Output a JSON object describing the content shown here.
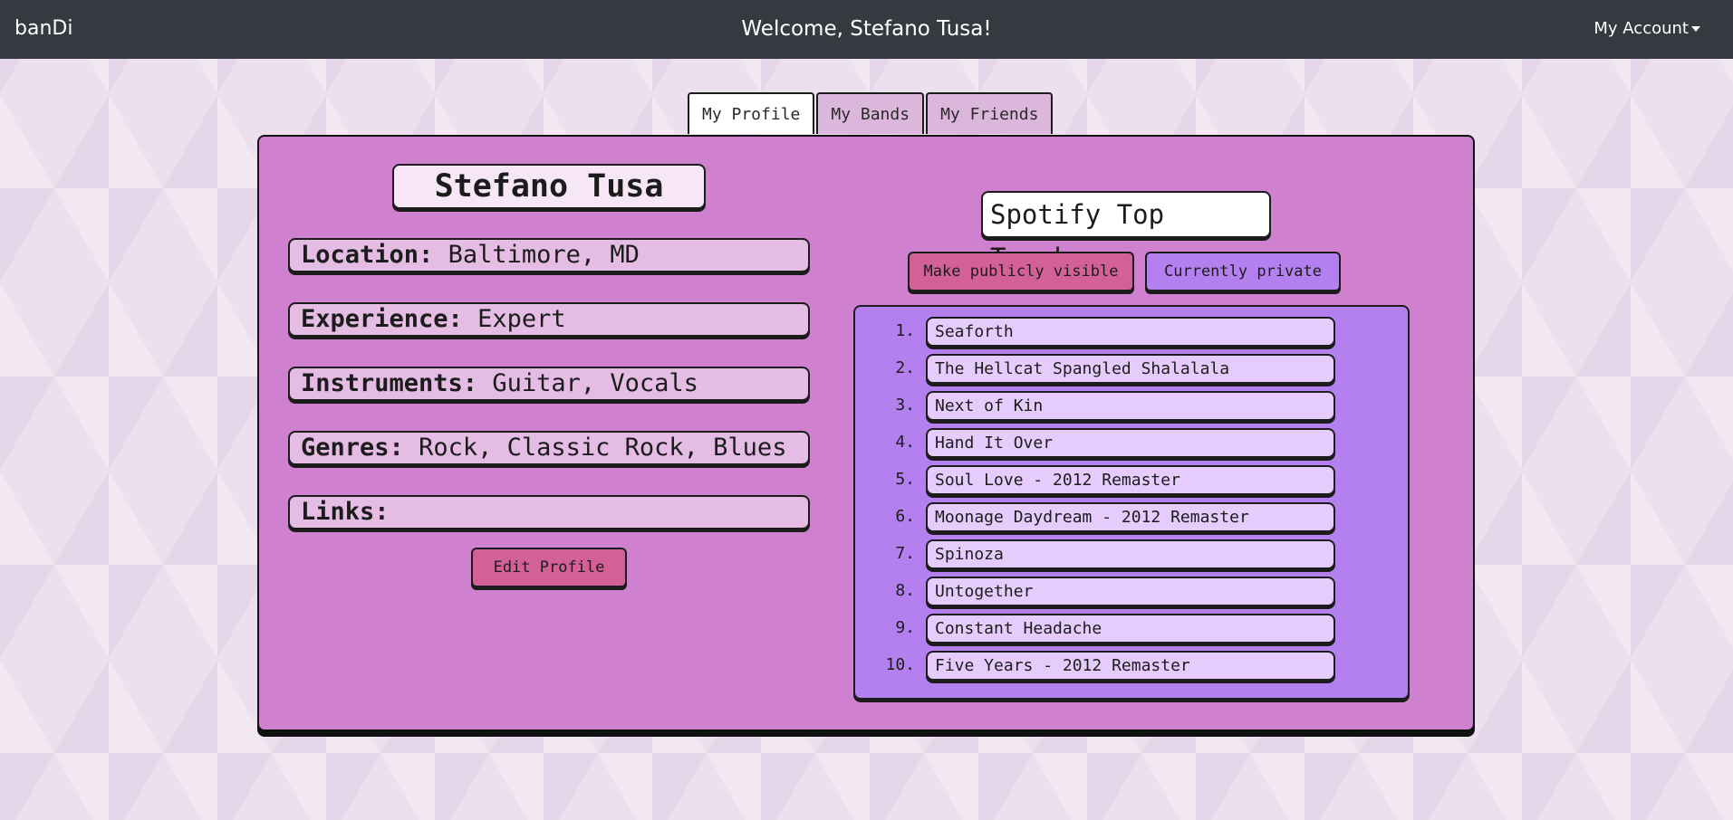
{
  "navbar": {
    "brand": "banDi",
    "welcome": "Welcome, Stefano Tusa!",
    "account_label": "My Account"
  },
  "tabs": [
    {
      "label": "My Profile",
      "active": true
    },
    {
      "label": "My Bands",
      "active": false
    },
    {
      "label": "My Friends",
      "active": false
    }
  ],
  "profile": {
    "name": "Stefano Tusa",
    "fields": [
      {
        "key": "Location:",
        "value": "Baltimore, MD"
      },
      {
        "key": "Experience:",
        "value": "Expert"
      },
      {
        "key": "Instruments:",
        "value": "Guitar, Vocals"
      },
      {
        "key": "Genres:",
        "value": "Rock, Classic Rock, Blues"
      },
      {
        "key": "Links:",
        "value": ""
      }
    ],
    "edit_label": "Edit Profile"
  },
  "spotify": {
    "title": "Spotify Top Tracks",
    "visibility_button": "Make publicly visible",
    "status": "Currently private",
    "tracks": [
      {
        "num": "1.",
        "name": "Seaforth"
      },
      {
        "num": "2.",
        "name": "The Hellcat Spangled Shalalala"
      },
      {
        "num": "3.",
        "name": "Next of Kin"
      },
      {
        "num": "4.",
        "name": "Hand It Over"
      },
      {
        "num": "5.",
        "name": "Soul Love - 2012 Remaster"
      },
      {
        "num": "6.",
        "name": "Moonage Daydream - 2012 Remaster"
      },
      {
        "num": "7.",
        "name": "Spinoza"
      },
      {
        "num": "8.",
        "name": "Untogether"
      },
      {
        "num": "9.",
        "name": "Constant Headache"
      },
      {
        "num": "10.",
        "name": "Five Years - 2012 Remaster"
      }
    ]
  },
  "colors": {
    "navbar": "#343a40",
    "card": "#cf80cf",
    "field": "#e4bce4",
    "pink_button": "#d36197",
    "purple_panel": "#b480f0",
    "track_item": "#e6ccfc"
  }
}
